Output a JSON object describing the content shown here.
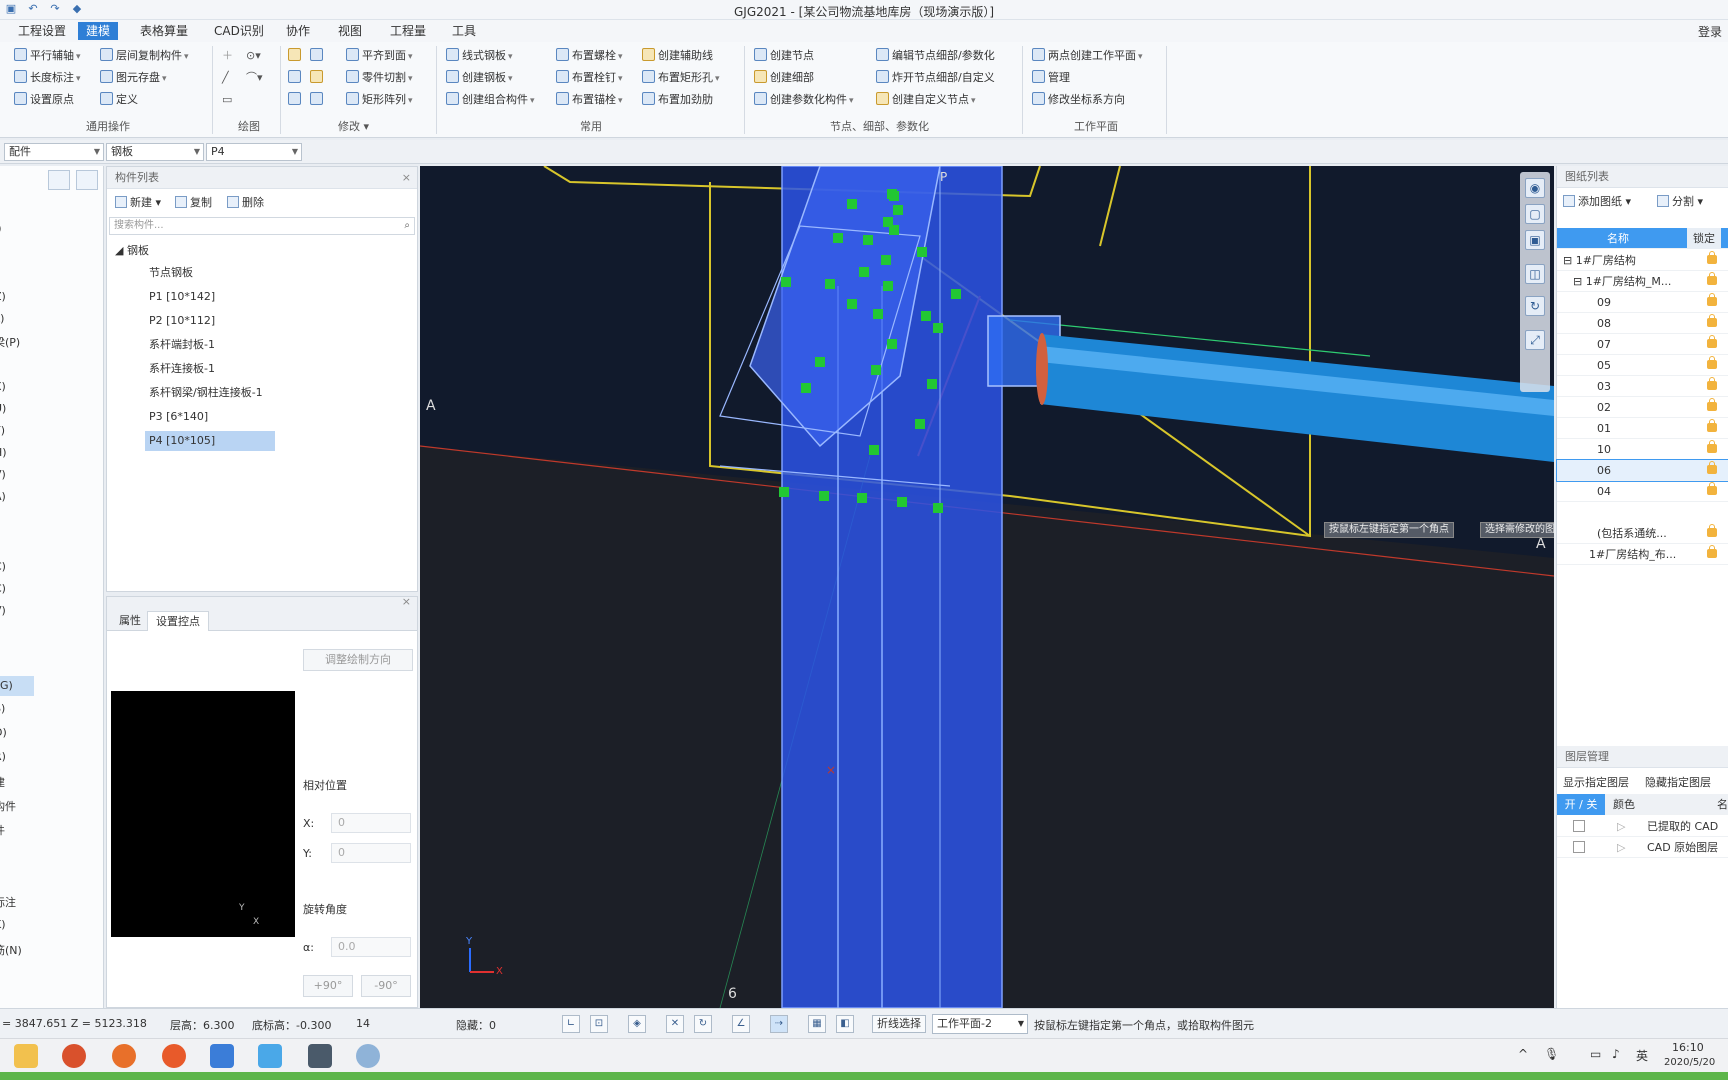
{
  "window": {
    "title": "GJG2021 - [某公司物流基地库房（现场演示版）]",
    "login": "登录"
  },
  "menu": {
    "tabs": [
      "工程设置",
      "建模",
      "表格算量",
      "CAD识别",
      "协作",
      "视图",
      "工程量",
      "工具"
    ],
    "active": "建模"
  },
  "ribbon": {
    "common_ops": {
      "label": "通用操作",
      "items": [
        "平行辅轴",
        "层间复制构件",
        "长度标注",
        "图元存盘",
        "设置原点",
        "定义"
      ]
    },
    "draw": {
      "label": "绘图"
    },
    "modify": {
      "label": "修改",
      "items": [
        "平齐到面",
        "零件切割",
        "矩形阵列"
      ]
    },
    "common": {
      "label": "常用",
      "items": [
        "线式钢板",
        "布置螺栓",
        "创建辅助线",
        "创建钢板",
        "布置栓钉",
        "布置矩形孔",
        "创建组合构件",
        "布置锚栓",
        "布置加劲肋"
      ]
    },
    "nodes": {
      "label": "节点、细部、参数化",
      "items": [
        "创建节点",
        "编辑节点细部/参数化",
        "创建细部",
        "炸开节点细部/自定义",
        "创建参数化构件",
        "创建自定义节点"
      ]
    },
    "workplane": {
      "label": "工作平面",
      "items": [
        "两点创建工作平面",
        "管理",
        "修改坐标系方向"
      ]
    }
  },
  "selectors": {
    "type": "配件",
    "subtype": "钢板",
    "item": "P4"
  },
  "left_nav": {
    "items": [
      "J)",
      "Z)",
      "L)",
      "梁(P)",
      "X)",
      "U)",
      "Y)",
      "H)",
      "V)",
      "A)",
      "C)",
      "C)",
      "V)",
      "G)",
      "S)",
      "D)",
      "R)",
      "建",
      "构件",
      "件",
      "标注",
      "K)",
      "筋(N)"
    ],
    "active_index": 13
  },
  "component_panel": {
    "title": "构件列表",
    "toolbar": {
      "new": "新建",
      "copy": "复制",
      "delete": "删除"
    },
    "search_placeholder": "搜索构件...",
    "tree_root": "钢板",
    "tree_items": [
      "节点钢板",
      "P1 [10*142]",
      "P2 [10*112]",
      "系杆端封板-1",
      "系杆连接板-1",
      "系杆钢梁/钢柱连接板-1",
      "P3 [6*140]",
      "P4 [10*105]"
    ],
    "selected_index": 7
  },
  "property_panel": {
    "tabs": [
      "属性",
      "设置控点"
    ],
    "active_tab": "设置控点",
    "adjust_button": "调整绘制方向",
    "relative_position": "相对位置",
    "x_label": "X:",
    "x_value": "0",
    "y_label": "Y:",
    "y_value": "0",
    "rotation_label": "旋转角度",
    "alpha_label": "α:",
    "alpha_value": "0.0",
    "plus90": "+90°",
    "minus90": "-90°",
    "preview_axis_x": "X",
    "preview_axis_y": "Y"
  },
  "view3d": {
    "axis_labels": {
      "left_A": "A",
      "right_A": "A",
      "bottom_6": "6",
      "top_P": "P"
    },
    "tooltip_1": "按鼠标左键指定第一个角点",
    "tooltip_2": "选择需修改的图元",
    "gizmo": {
      "x": "X",
      "y": "Y"
    },
    "colors": {
      "background": "#111a2c",
      "column": "#2b53e6",
      "grid_yellow": "#d8c62b",
      "axis_red": "#c0392b",
      "control_point": "#22c733",
      "beam": "#1e87d6"
    }
  },
  "right_panel": {
    "title": "图纸列表",
    "toolbar": {
      "add": "添加图纸",
      "split": "分割"
    },
    "columns": {
      "name": "名称",
      "lock": "锁定"
    },
    "root": "1#厂房结构",
    "sub_root": "1#厂房结构_M...",
    "sheets": [
      "09",
      "08",
      "07",
      "05",
      "03",
      "02",
      "01",
      "10",
      "06",
      "04"
    ],
    "selected_sheet": "06",
    "extra_items": [
      "(包括系通统...",
      "1#厂房结构_布..."
    ],
    "layer_title": "图层管理",
    "layer_buttons": {
      "show": "显示指定图层",
      "hide": "隐藏指定图层"
    },
    "layer_columns": {
      "toggle": "开 / 关",
      "color": "颜色",
      "name": "名"
    },
    "layers": [
      "已提取的 CAD",
      "CAD 原始图层"
    ]
  },
  "statusbar": {
    "coords": "= 3847.651 Z = 5123.318",
    "floor_height_label": "层高：6.300",
    "bottom_height_label": "底标高：-0.300",
    "count": "14",
    "hidden": "隐藏：0",
    "polyline_select": "折线选择",
    "workplane": "工作平面-2",
    "prompt": "按鼠标左键指定第一个角点，或拾取构件图元"
  },
  "taskbar": {
    "tray_lang": "英",
    "time": "16:10",
    "date": "2020/5/20"
  }
}
